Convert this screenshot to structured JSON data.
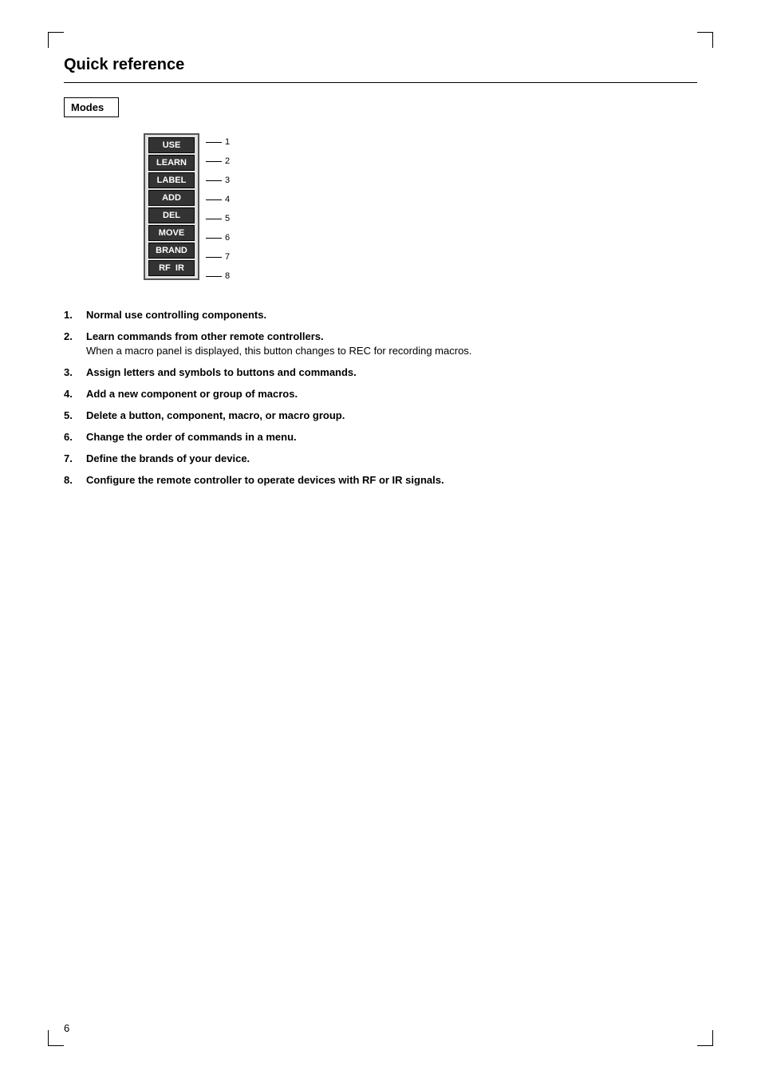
{
  "page": {
    "title": "Quick reference",
    "page_number": "6"
  },
  "modes_label": "Modes",
  "remote_buttons": [
    {
      "label": "USE",
      "number": "1"
    },
    {
      "label": "LEARN",
      "number": "2"
    },
    {
      "label": "LABEL",
      "number": "3"
    },
    {
      "label": "ADD",
      "number": "4"
    },
    {
      "label": "DEL",
      "number": "5"
    },
    {
      "label": "MOVE",
      "number": "6"
    },
    {
      "label": "BRAND",
      "number": "7"
    },
    {
      "label": "RF  IR",
      "number": "8"
    }
  ],
  "list_items": [
    {
      "num": "1.",
      "main": "Normal use controlling components.",
      "sub": ""
    },
    {
      "num": "2.",
      "main": "Learn commands from other remote controllers.",
      "sub": "When a macro panel is displayed, this button changes to REC for recording macros."
    },
    {
      "num": "3.",
      "main": "Assign letters and symbols to buttons and commands.",
      "sub": ""
    },
    {
      "num": "4.",
      "main": "Add a new component or group of macros.",
      "sub": ""
    },
    {
      "num": "5.",
      "main": "Delete a button, component, macro, or macro group.",
      "sub": ""
    },
    {
      "num": "6.",
      "main": "Change the order of commands in a menu.",
      "sub": ""
    },
    {
      "num": "7.",
      "main": "Define the brands of your device.",
      "sub": ""
    },
    {
      "num": "8.",
      "main": "Configure the remote controller to operate devices with RF or IR signals.",
      "sub": ""
    }
  ]
}
